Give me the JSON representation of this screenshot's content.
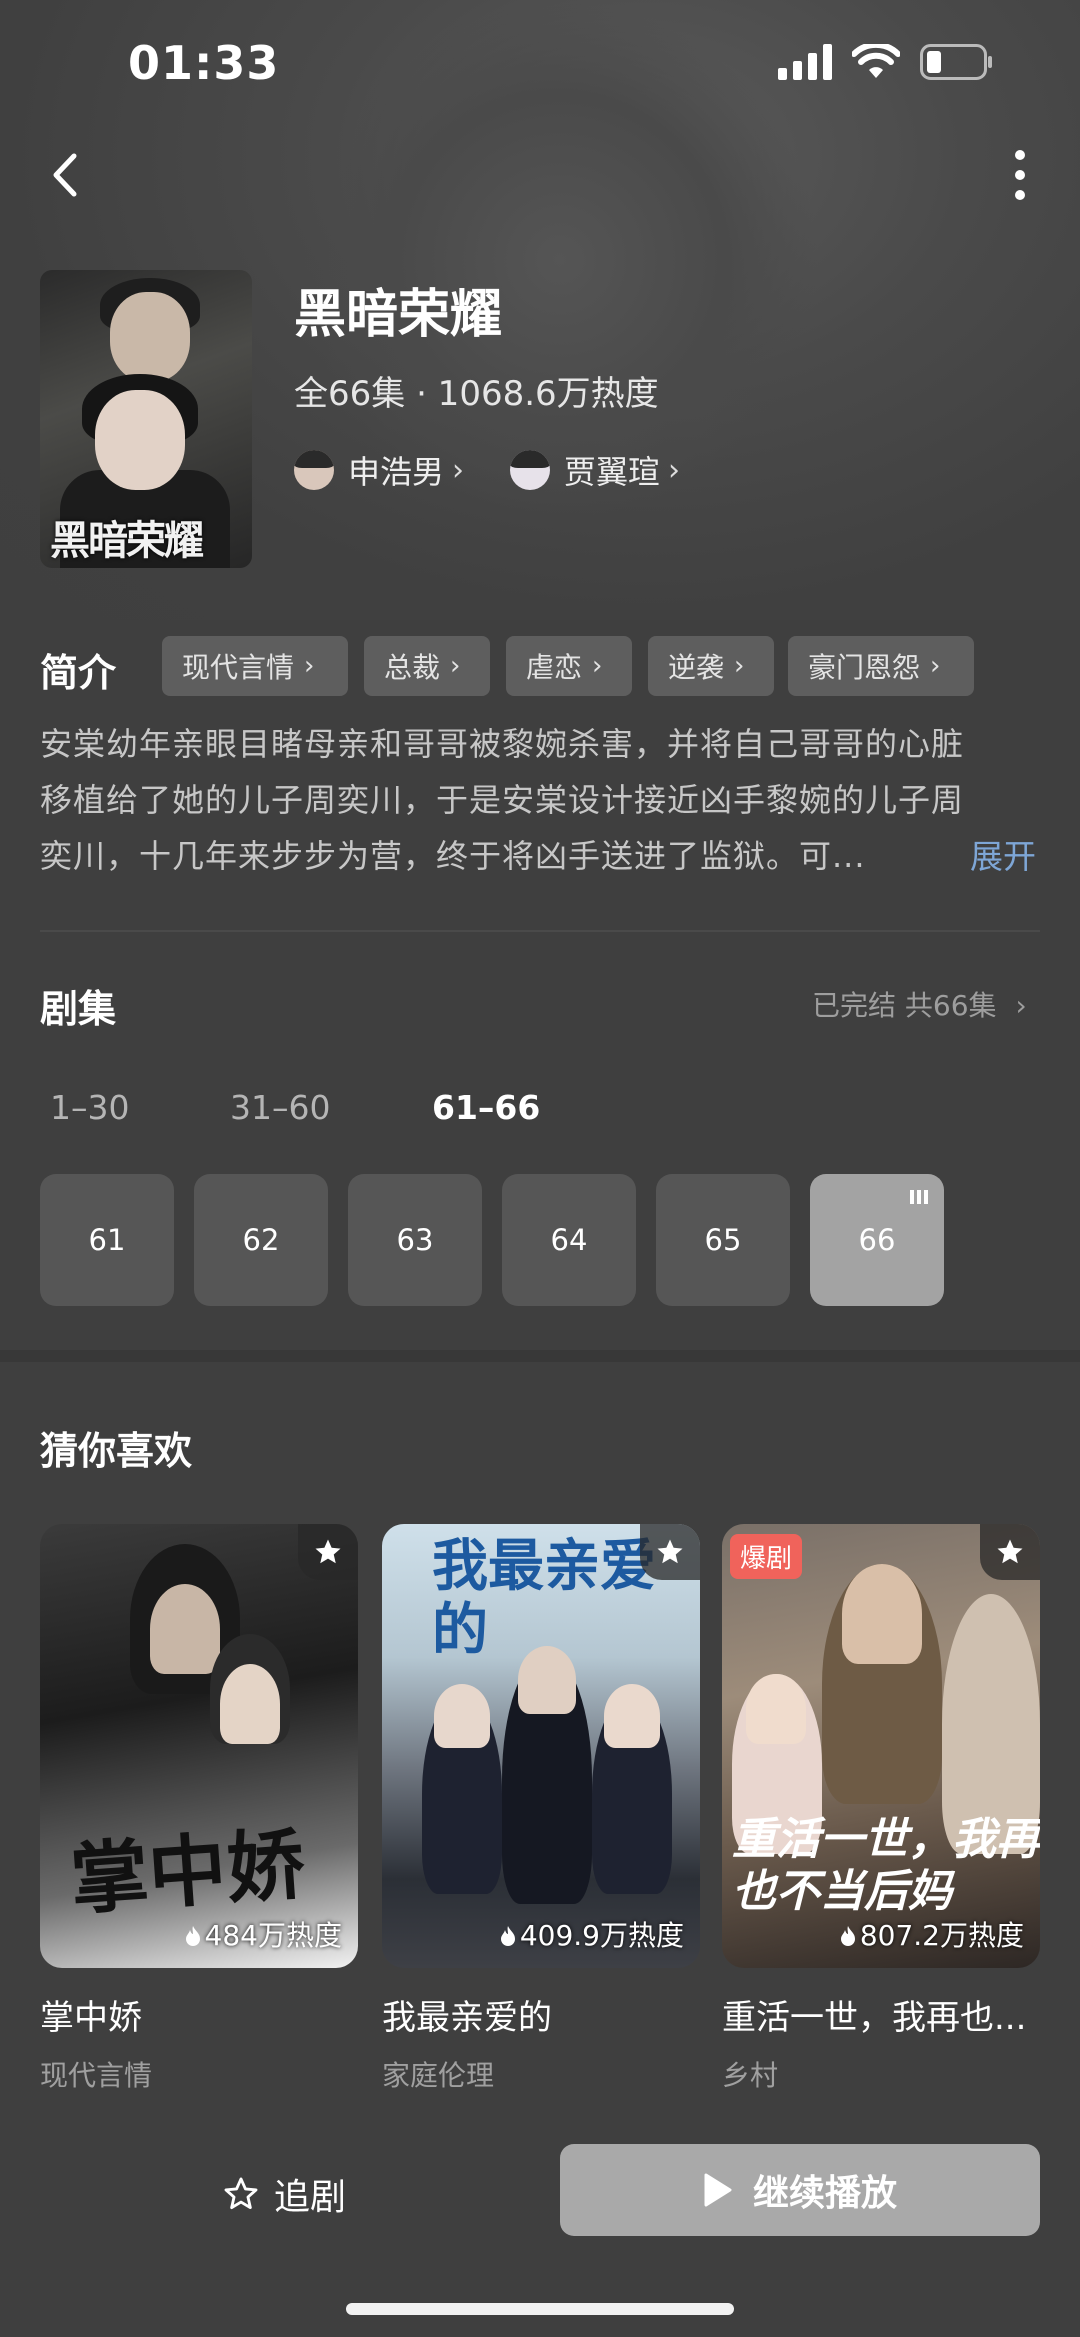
{
  "status_bar": {
    "time": "01:33"
  },
  "header": {
    "title": "黑暗荣耀",
    "cover_title": "黑暗荣耀",
    "meta": "全66集 · 1068.6万热度",
    "actors": [
      {
        "name": "申浩男"
      },
      {
        "name": "贾翼瑄"
      }
    ]
  },
  "intro": {
    "label": "简介",
    "tags": [
      "现代言情",
      "总裁",
      "虐恋",
      "逆袭",
      "豪门恩怨"
    ],
    "lines": [
      "安棠幼年亲眼目睹母亲和哥哥被黎婉杀害，并将自己哥哥的心脏",
      "移植给了她的儿子周奕川，于是安棠设计接近凶手黎婉的儿子周",
      "奕川，十几年来步步为营，终于将凶手送进了监狱。可..."
    ],
    "expand_label": "展开"
  },
  "episodes": {
    "title": "剧集",
    "status": "已完结 共66集",
    "ranges": [
      "1–30",
      "31–60",
      "61–66"
    ],
    "active_range": "61–66",
    "items": [
      "61",
      "62",
      "63",
      "64",
      "65",
      "66"
    ],
    "current": "66"
  },
  "recommend": {
    "title": "猜你喜欢",
    "cards": [
      {
        "name": "掌中娇",
        "genre": "现代言情",
        "heat": "484万热度",
        "art": "掌中娇",
        "badge": ""
      },
      {
        "name": "我最亲爱的",
        "genre": "家庭伦理",
        "heat": "409.9万热度",
        "art": "我最亲爱的",
        "badge": ""
      },
      {
        "name": "重活一世，我再也...",
        "genre": "乡村",
        "heat": "807.2万热度",
        "art": "重活一世，我再也不当后妈",
        "badge": "爆剧"
      }
    ]
  },
  "bottom_bar": {
    "follow_label": "追剧",
    "play_label": "继续播放"
  },
  "colors": {
    "background": "#3f3f3f",
    "expand_link": "#7ea6d6",
    "hot_badge": "#f0635b",
    "play_button": "#a9a9a9"
  },
  "icons": [
    "signal-icon",
    "wifi-icon",
    "battery-icon",
    "back-arrow-icon",
    "more-vertical-icon",
    "chevron-right-icon",
    "star-icon",
    "fire-icon",
    "play-icon",
    "playing-bars-icon"
  ]
}
